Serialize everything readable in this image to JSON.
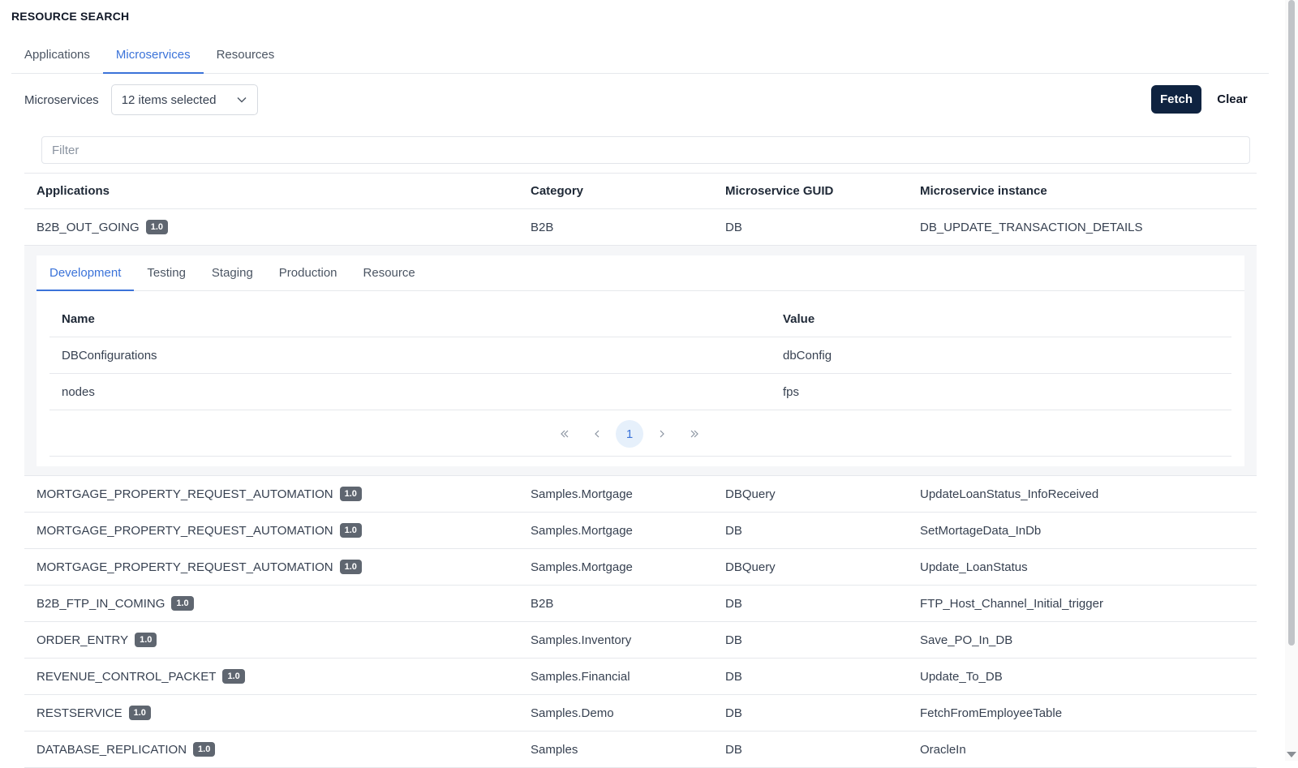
{
  "page": {
    "title": "RESOURCE SEARCH"
  },
  "tabs": [
    {
      "label": "Applications",
      "active": false
    },
    {
      "label": "Microservices",
      "active": true
    },
    {
      "label": "Resources",
      "active": false
    }
  ],
  "filter_bar": {
    "label": "Microservices",
    "select_value": "12 items selected",
    "fetch_label": "Fetch",
    "clear_label": "Clear",
    "filter_placeholder": "Filter"
  },
  "table": {
    "columns": [
      "Applications",
      "Category",
      "Microservice GUID",
      "Microservice instance"
    ],
    "rows": [
      {
        "app": "B2B_OUT_GOING",
        "version": "1.0",
        "category": "B2B",
        "guid": "DB",
        "instance": "DB_UPDATE_TRANSACTION_DETAILS"
      },
      {
        "app": "MORTGAGE_PROPERTY_REQUEST_AUTOMATION",
        "version": "1.0",
        "category": "Samples.Mortgage",
        "guid": "DBQuery",
        "instance": "UpdateLoanStatus_InfoReceived"
      },
      {
        "app": "MORTGAGE_PROPERTY_REQUEST_AUTOMATION",
        "version": "1.0",
        "category": "Samples.Mortgage",
        "guid": "DB",
        "instance": "SetMortageData_InDb"
      },
      {
        "app": "MORTGAGE_PROPERTY_REQUEST_AUTOMATION",
        "version": "1.0",
        "category": "Samples.Mortgage",
        "guid": "DBQuery",
        "instance": "Update_LoanStatus"
      },
      {
        "app": "B2B_FTP_IN_COMING",
        "version": "1.0",
        "category": "B2B",
        "guid": "DB",
        "instance": "FTP_Host_Channel_Initial_trigger"
      },
      {
        "app": "ORDER_ENTRY",
        "version": "1.0",
        "category": "Samples.Inventory",
        "guid": "DB",
        "instance": "Save_PO_In_DB"
      },
      {
        "app": "REVENUE_CONTROL_PACKET",
        "version": "1.0",
        "category": "Samples.Financial",
        "guid": "DB",
        "instance": "Update_To_DB"
      },
      {
        "app": "RESTSERVICE",
        "version": "1.0",
        "category": "Samples.Demo",
        "guid": "DB",
        "instance": "FetchFromEmployeeTable"
      },
      {
        "app": "DATABASE_REPLICATION",
        "version": "1.0",
        "category": "Samples",
        "guid": "DB",
        "instance": "OracleIn"
      }
    ]
  },
  "detail": {
    "tabs": [
      {
        "label": "Development",
        "active": true
      },
      {
        "label": "Testing",
        "active": false
      },
      {
        "label": "Staging",
        "active": false
      },
      {
        "label": "Production",
        "active": false
      },
      {
        "label": "Resource",
        "active": false
      }
    ],
    "columns": [
      "Name",
      "Value"
    ],
    "rows": [
      {
        "name": "DBConfigurations",
        "value": "dbConfig"
      },
      {
        "name": "nodes",
        "value": "fps"
      }
    ],
    "pagination": {
      "current_page": "1"
    }
  },
  "icons": {
    "select_chevron": "chevron-down-icon",
    "first_page": "double-chevron-left-icon",
    "prev_page": "chevron-left-icon",
    "next_page": "chevron-right-icon",
    "last_page": "double-chevron-right-icon"
  },
  "colors": {
    "accent": "#3b73d9",
    "fetch_button": "#0f2340",
    "badge": "#5f6670",
    "expanded_bg": "#f5f6f8"
  }
}
